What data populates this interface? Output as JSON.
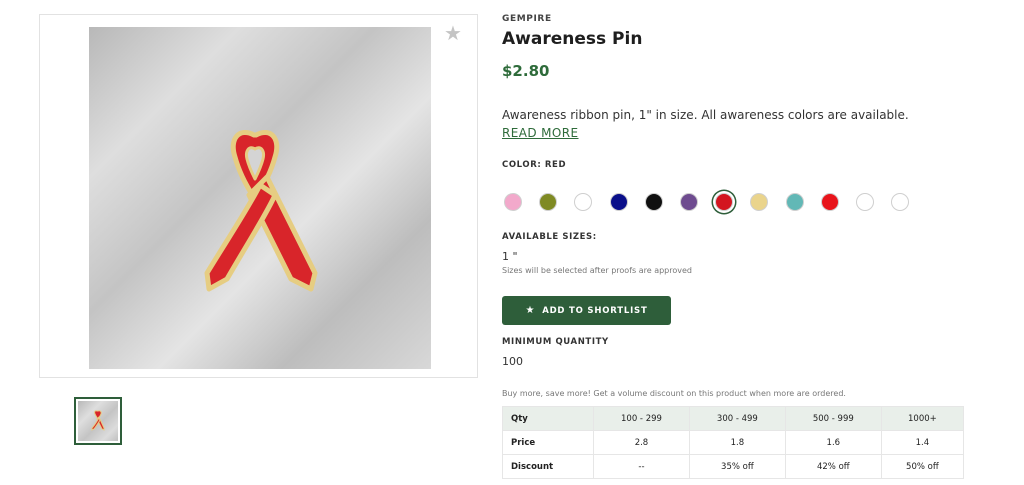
{
  "product": {
    "brand": "GEMPIRE",
    "title": "Awareness Pin",
    "price": "$2.80",
    "description": "Awareness ribbon pin, 1\" in size. All awareness colors are available.",
    "read_more": "READ MORE"
  },
  "gallery": {
    "main_image": "awareness-ribbon-pin-image",
    "favorite_icon": "star-icon",
    "thumbnails": [
      "awareness-ribbon-pin-thumbnail"
    ]
  },
  "color": {
    "label": "COLOR: RED",
    "swatches": [
      {
        "name": "pink",
        "hex": "#f2a9cb"
      },
      {
        "name": "olive",
        "hex": "#7f8a23"
      },
      {
        "name": "white",
        "hex": "#ffffff"
      },
      {
        "name": "navy",
        "hex": "#0a0f8a"
      },
      {
        "name": "black",
        "hex": "#101010"
      },
      {
        "name": "purple",
        "hex": "#6e4b8f"
      },
      {
        "name": "red",
        "hex": "#d31620",
        "selected": true
      },
      {
        "name": "yellow",
        "hex": "#ead48c"
      },
      {
        "name": "teal",
        "hex": "#62b8b6"
      },
      {
        "name": "bright-red",
        "hex": "#e8141b"
      },
      {
        "name": "white-2",
        "hex": "#ffffff"
      },
      {
        "name": "white-3",
        "hex": "#ffffff"
      }
    ]
  },
  "sizes": {
    "label": "AVAILABLE SIZES:",
    "value": "1 \"",
    "note": "Sizes will be selected after proofs are approved"
  },
  "shortlist_button": {
    "label": "ADD TO SHORTLIST",
    "icon": "star-icon"
  },
  "minimum_quantity": {
    "label": "MINIMUM QUANTITY",
    "value": "100"
  },
  "volume": {
    "note": "Buy more, save more! Get a volume discount on this product when more are ordered.",
    "table": {
      "header": [
        "Qty",
        "100 - 299",
        "300 - 499",
        "500 - 999",
        "1000+"
      ],
      "rows": [
        [
          "Price",
          "2.8",
          "1.8",
          "1.6",
          "1.4"
        ],
        [
          "Discount",
          "--",
          "35% off",
          "42% off",
          "50% off"
        ]
      ]
    }
  },
  "colors": {
    "accent": "#2e5e3a",
    "price": "#2e6b3a",
    "ribbon": "#d8252a",
    "ribbon_outline": "#e4c97a"
  }
}
